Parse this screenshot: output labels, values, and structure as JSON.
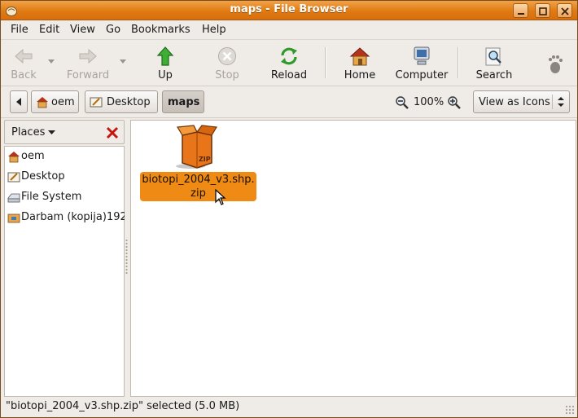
{
  "window": {
    "title": "maps - File Browser"
  },
  "menubar": {
    "items": [
      "File",
      "Edit",
      "View",
      "Go",
      "Bookmarks",
      "Help"
    ]
  },
  "toolbar": {
    "back": "Back",
    "forward": "Forward",
    "up": "Up",
    "stop": "Stop",
    "reload": "Reload",
    "home": "Home",
    "computer": "Computer",
    "search": "Search"
  },
  "location": {
    "path": [
      "oem",
      "Desktop",
      "maps"
    ],
    "zoom": "100%",
    "view_mode": "View as Icons"
  },
  "sidebar": {
    "header": "Places",
    "items": [
      {
        "label": "oem",
        "icon": "home-folder-icon"
      },
      {
        "label": "Desktop",
        "icon": "desktop-icon"
      },
      {
        "label": "File System",
        "icon": "drive-icon"
      },
      {
        "label": "Darbam (kopija)192",
        "icon": "network-folder-icon"
      }
    ]
  },
  "files": [
    {
      "name_line1": "biotopi_2004_v3.shp.",
      "name_line2": "zip",
      "icon": "zip-archive-icon",
      "selected": true
    }
  ],
  "status": {
    "text": "\"biotopi_2004_v3.shp.zip\" selected (5.0 MB)"
  },
  "colors": {
    "titlebar": "#e07a12",
    "selection": "#ef8a14",
    "up_arrow": "#2f9a2a"
  }
}
